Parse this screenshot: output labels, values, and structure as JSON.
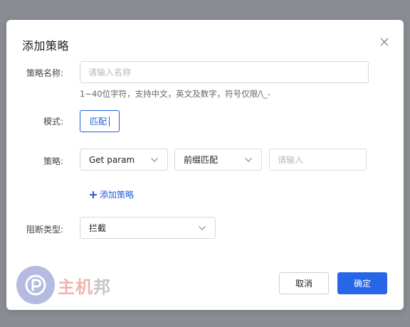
{
  "dialog": {
    "title": "添加策略"
  },
  "form": {
    "name_label": "策略名称:",
    "name_placeholder": "请输入名称",
    "name_hint": "1~40位字符，支持中文，英文及数字，符号仅限/\\_-",
    "mode_label": "模式:",
    "mode_value": "匹配",
    "strategy_label": "策略:",
    "strategy_param": "Get param",
    "strategy_match": "前缀匹配",
    "strategy_value_placeholder": "请输入",
    "add_strategy_label": "添加策略",
    "block_type_label": "阻断类型:",
    "block_type_value": "拦截"
  },
  "footer": {
    "cancel_label": "取消",
    "ok_label": "确定"
  },
  "watermark": {
    "text_main": "主机",
    "text_last": "邦"
  },
  "colors": {
    "accent": "#2866e8",
    "overlay": "#8a8d93"
  }
}
